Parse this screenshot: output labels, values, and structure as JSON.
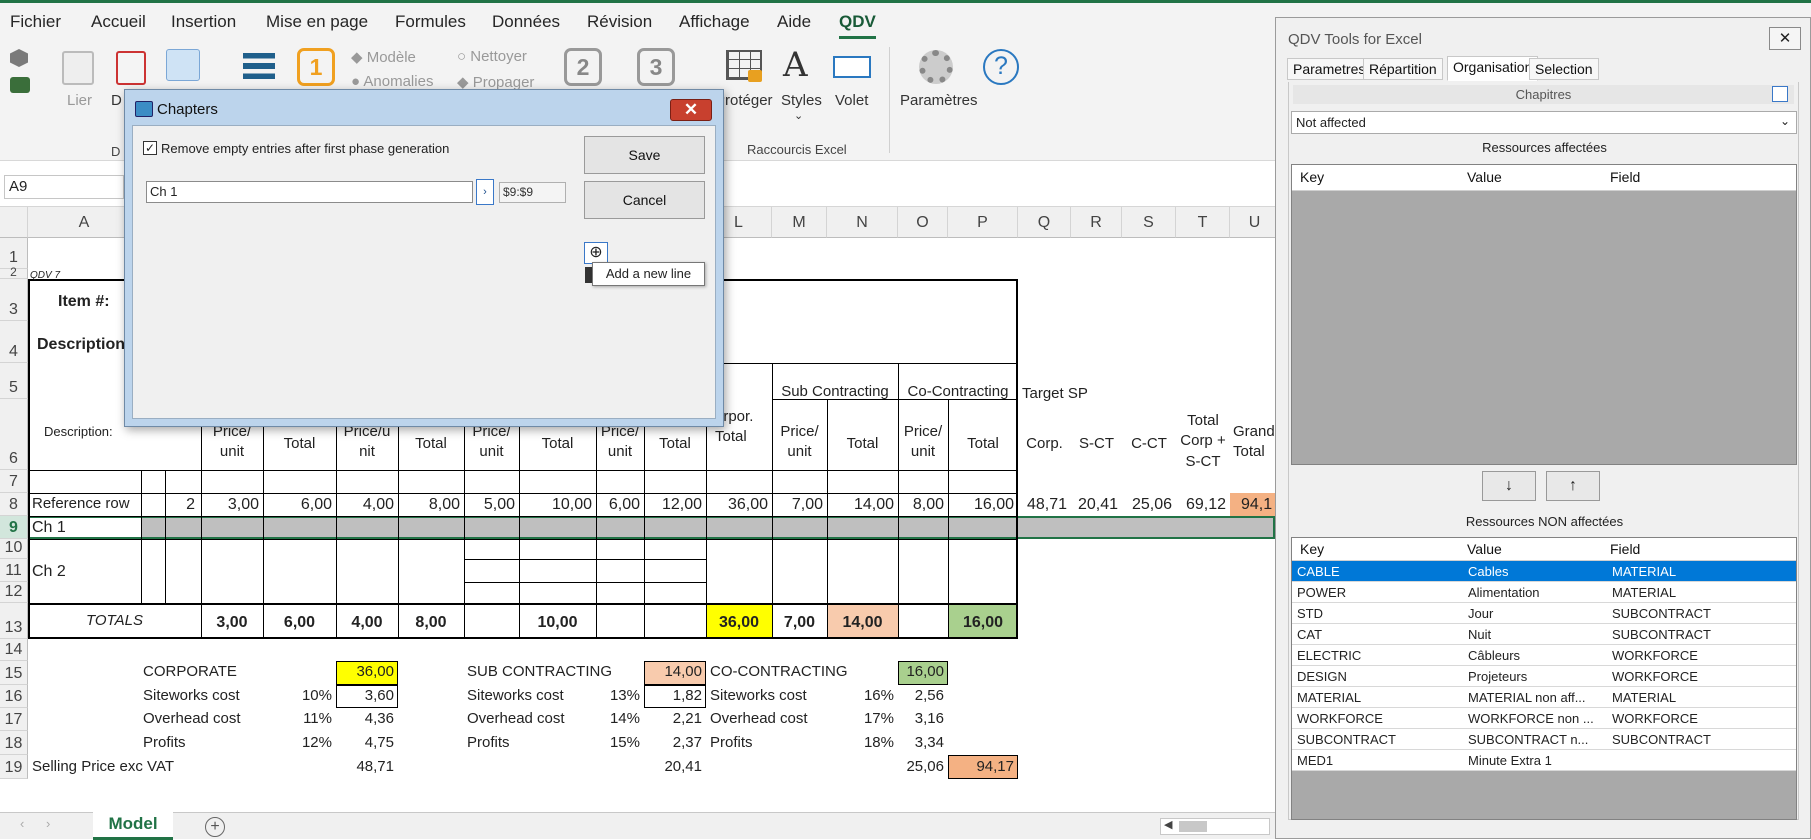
{
  "menu": [
    "Fichier",
    "Accueil",
    "Insertion",
    "Mise en page",
    "Formules",
    "Données",
    "Révision",
    "Affichage",
    "Aide",
    "QDV"
  ],
  "ribbon": {
    "lier": "Lier",
    "d": "D",
    "modele": "Modèle",
    "nettoyer": "Nettoyer",
    "anomalies": "Anomalies",
    "propager": "Propager",
    "n1": "1",
    "n2": "2",
    "n3": "3",
    "proteger": "Protéger",
    "styles": "Styles",
    "volet": "Volet",
    "parametres": "Paramètres",
    "group_raccourcis": "Raccourcis Excel",
    "group_d": "D"
  },
  "name_box": "A9",
  "columns": [
    "A",
    "L",
    "M",
    "N",
    "O",
    "P",
    "Q",
    "R",
    "S",
    "T",
    "U"
  ],
  "rows": [
    "1",
    "2",
    "3",
    "4",
    "5",
    "6",
    "7",
    "8",
    "9",
    "10",
    "11",
    "12",
    "13",
    "14",
    "15",
    "16",
    "17",
    "18",
    "19"
  ],
  "sheet": {
    "qdv7": "QDV 7",
    "item": "Item #:",
    "description_head": "Description",
    "description_label": "Description:",
    "price_unit": "Price/ unit",
    "price_u_nit": "Price/u nit",
    "price_unit_partial": "Price/ unit",
    "total": "Total",
    "corpor_total": "orpor. Total",
    "sub_contracting": "Sub Contracting",
    "co_contracting": "Co-Contracting",
    "target_sp": "Target SP",
    "corp": "Corp.",
    "s_ct": "S-CT",
    "c_ct": "C-CT",
    "total_corp": "Total Corp + S-CT",
    "grand_total": "Grand Total",
    "reference_row": {
      "label": "Reference row",
      "qty": "2",
      "values": [
        "3,00",
        "6,00",
        "4,00",
        "8,00",
        "5,00",
        "10,00",
        "6,00",
        "12,00",
        "36,00",
        "7,00",
        "14,00",
        "8,00",
        "16,00",
        "48,71",
        "20,41",
        "25,06",
        "69,12",
        "94,1"
      ]
    },
    "ch1": "Ch 1",
    "ch2": "Ch 2",
    "totals": {
      "label": "TOTALS",
      "values": [
        "3,00",
        "6,00",
        "4,00",
        "8,00",
        "10,00",
        "36,00",
        "7,00",
        "14,00",
        "16,00"
      ]
    },
    "corporate": {
      "label": "CORPORATE",
      "value": "36,00"
    },
    "sub_contracting_block": {
      "label": "SUB CONTRACTING",
      "value": "14,00"
    },
    "co_contracting_block": {
      "label": "CO-CONTRACTING",
      "value": "16,00"
    },
    "siteworks": {
      "label": "Siteworks cost",
      "corp_pct": "10%",
      "corp_val": "3,60",
      "sub_pct": "13%",
      "sub_val": "1,82",
      "co_pct": "16%",
      "co_val": "2,56"
    },
    "overhead": {
      "label": "Overhead cost",
      "corp_pct": "11%",
      "corp_val": "4,36",
      "sub_pct": "14%",
      "sub_val": "2,21",
      "co_pct": "17%",
      "co_val": "3,16"
    },
    "profits": {
      "label": "Profits",
      "corp_pct": "12%",
      "corp_val": "4,75",
      "sub_pct": "15%",
      "sub_val": "2,37",
      "co_pct": "18%",
      "co_val": "3,34"
    },
    "selling": {
      "label": "Selling Price  exc VAT",
      "corp": "48,71",
      "sub": "20,41",
      "co": "25,06",
      "grand": "94,17"
    }
  },
  "sheet_tab": "Model",
  "dialog": {
    "title": "Chapters",
    "checkbox_label": "Remove empty entries after first phase generation",
    "entry_value": "Ch 1",
    "range_value": "$9:$9",
    "save": "Save",
    "cancel": "Cancel",
    "tooltip": "Add a new line"
  },
  "panel": {
    "title": "QDV Tools for Excel",
    "tabs": [
      "Parametres",
      "Répartition",
      "Organisation",
      "Selection"
    ],
    "chapitres": "Chapitres",
    "dropdown": "Not affected",
    "affected_title": "Ressources affectées",
    "non_affected_title": "Ressources NON affectées",
    "headers": [
      "Key",
      "Value",
      "Field"
    ],
    "rows": [
      [
        "CABLE",
        "Cables",
        "MATERIAL"
      ],
      [
        "POWER",
        "Alimentation",
        "MATERIAL"
      ],
      [
        "STD",
        "Jour",
        "SUBCONTRACT"
      ],
      [
        "CAT",
        "Nuit",
        "SUBCONTRACT"
      ],
      [
        "ELECTRIC",
        "Câbleurs",
        "WORKFORCE"
      ],
      [
        "DESIGN",
        "Projeteurs",
        "WORKFORCE"
      ],
      [
        "MATERIAL",
        "MATERIAL non aff...",
        "MATERIAL"
      ],
      [
        "WORKFORCE",
        "WORKFORCE non ...",
        "WORKFORCE"
      ],
      [
        "SUBCONTRACT",
        "SUBCONTRACT n...",
        "SUBCONTRACT"
      ],
      [
        "MED1",
        "Minute Extra 1",
        ""
      ]
    ],
    "down": "↓",
    "up": "↑"
  },
  "colors": {
    "excel_green": "#217346",
    "yellow": "#ffff00",
    "salmon": "#f8cbad",
    "green_fill": "#a9d08e",
    "orange": "#f4b183"
  }
}
